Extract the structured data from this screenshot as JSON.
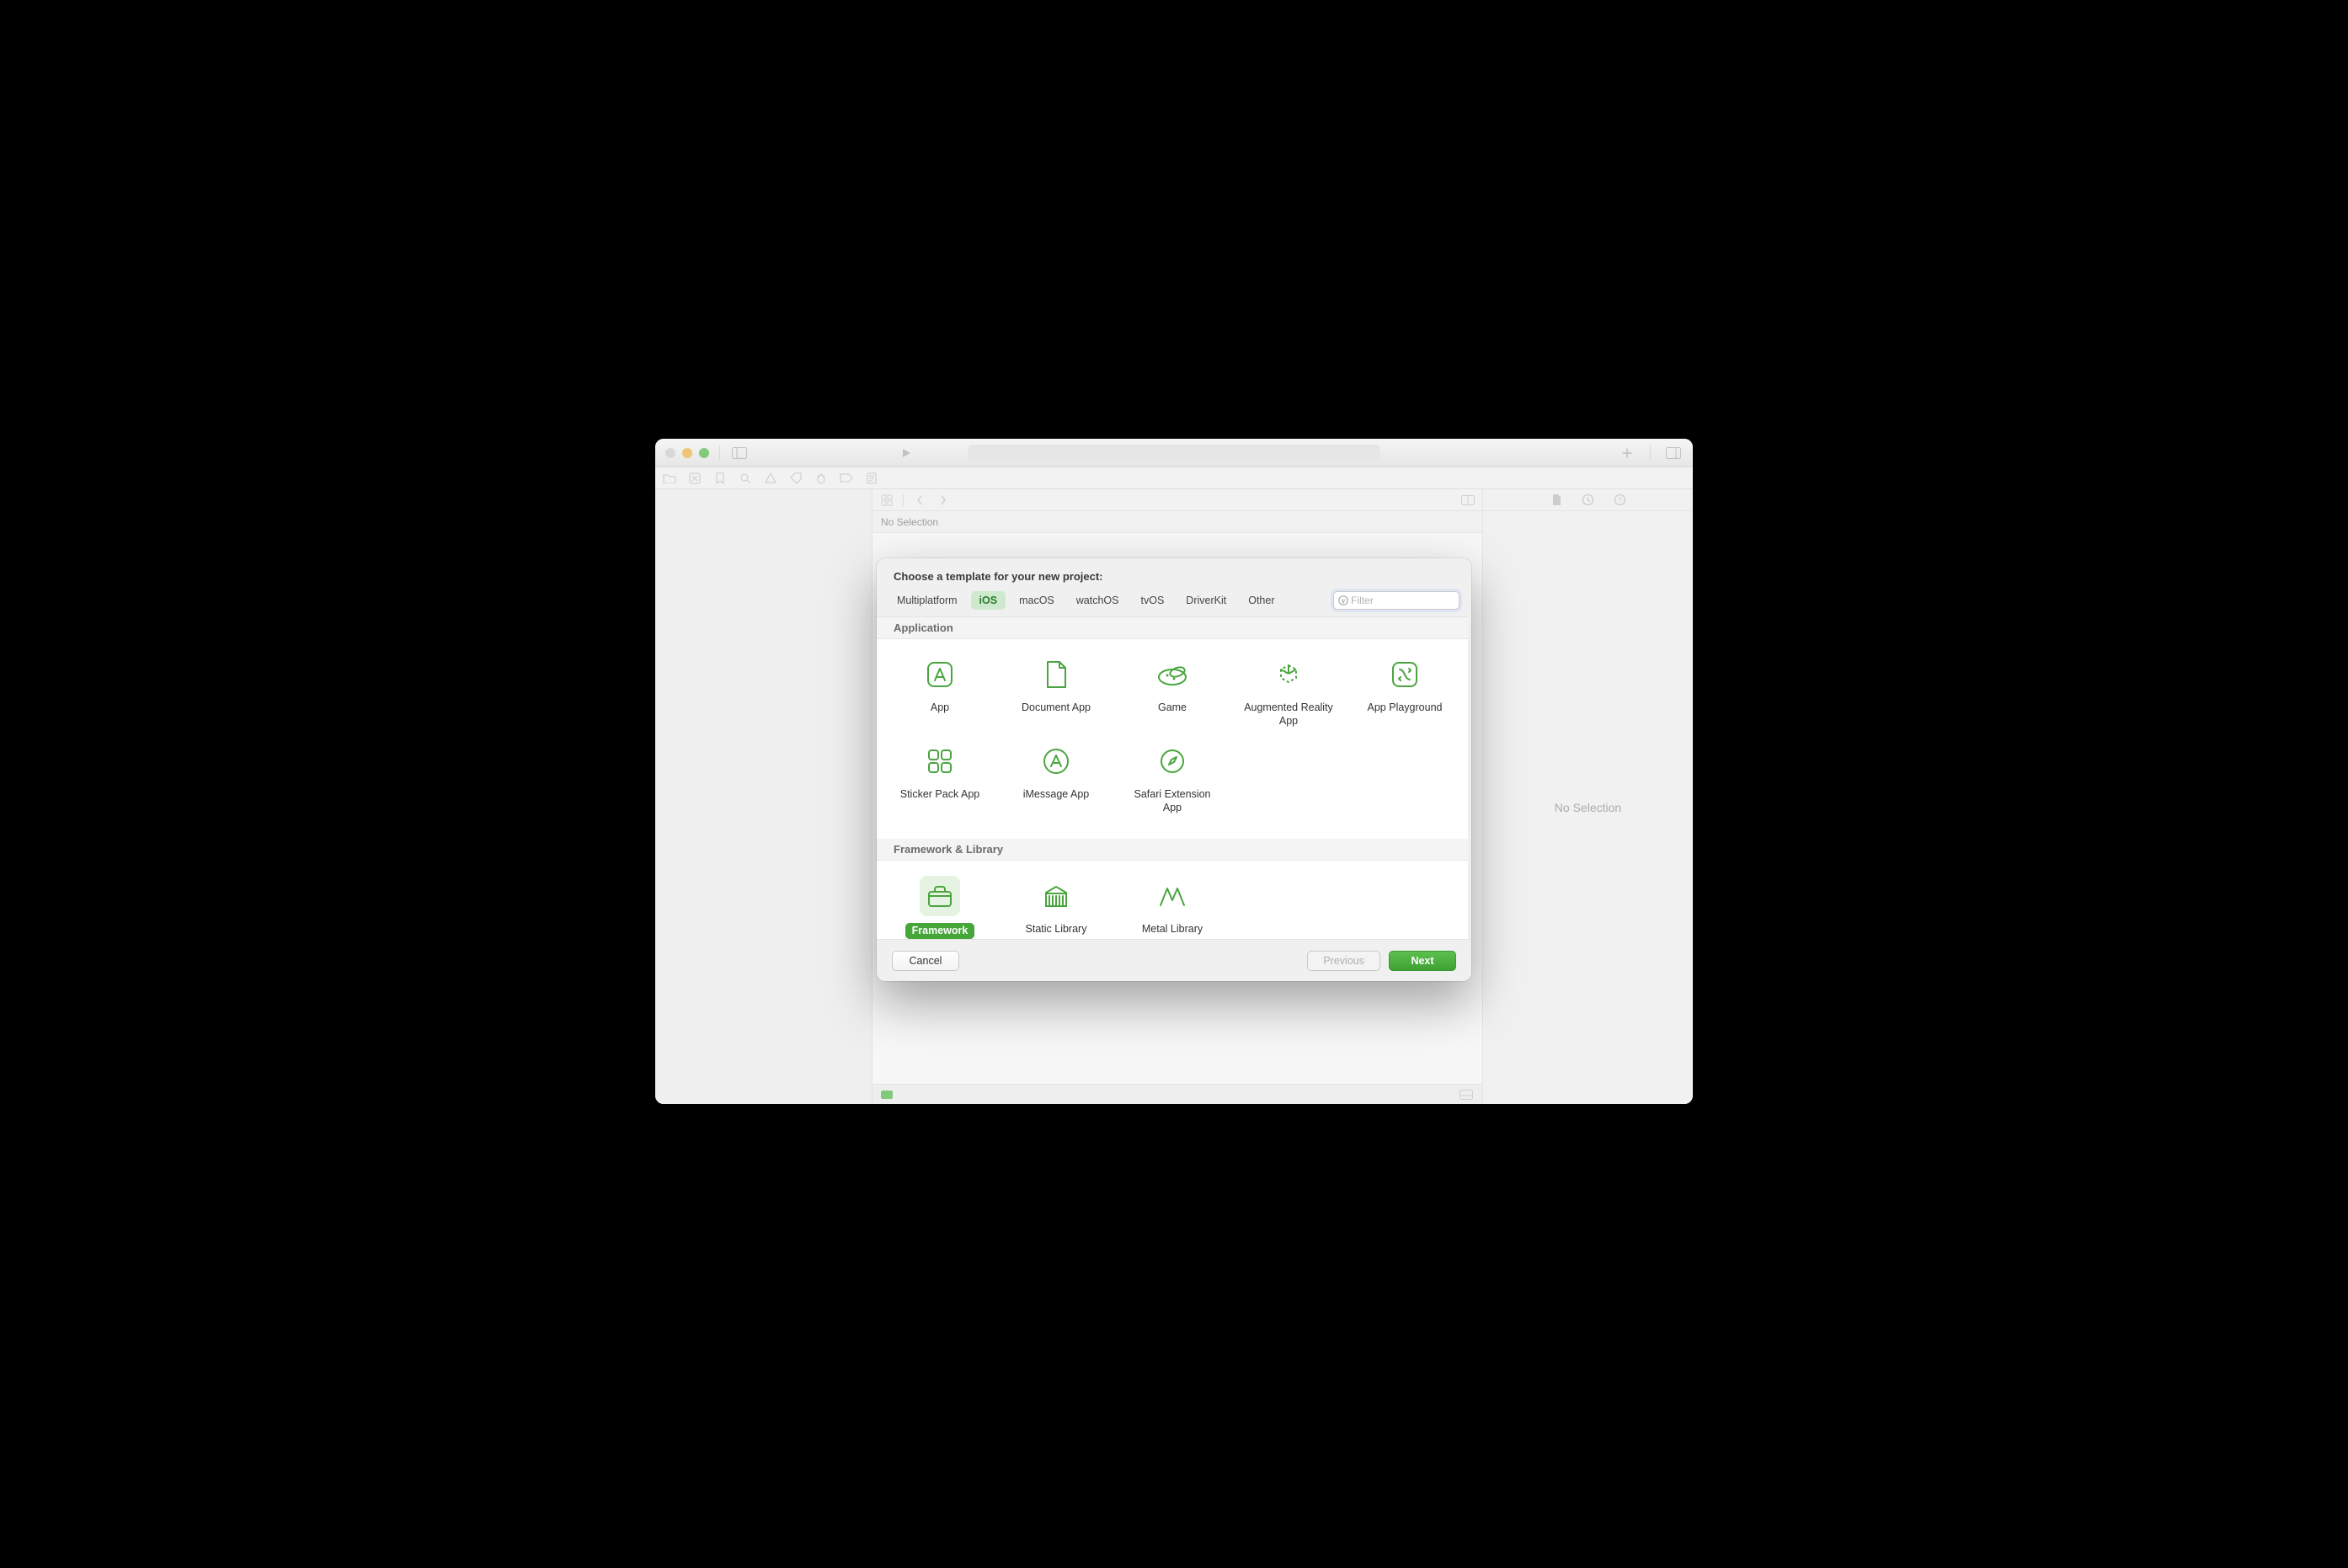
{
  "editor": {
    "no_selection": "No Selection"
  },
  "inspector": {
    "no_selection": "No Selection"
  },
  "sheet": {
    "title": "Choose a template for your new project:",
    "tabs": [
      "Multiplatform",
      "iOS",
      "macOS",
      "watchOS",
      "tvOS",
      "DriverKit",
      "Other"
    ],
    "active_tab_index": 1,
    "filter_placeholder": "Filter",
    "sections": [
      {
        "name": "Application",
        "items": [
          {
            "label": "App",
            "icon": "app"
          },
          {
            "label": "Document App",
            "icon": "document"
          },
          {
            "label": "Game",
            "icon": "game"
          },
          {
            "label": "Augmented Reality App",
            "icon": "ar"
          },
          {
            "label": "App Playground",
            "icon": "playground"
          },
          {
            "label": "Sticker Pack App",
            "icon": "sticker"
          },
          {
            "label": "iMessage App",
            "icon": "imessage"
          },
          {
            "label": "Safari Extension App",
            "icon": "safari"
          }
        ]
      },
      {
        "name": "Framework & Library",
        "items": [
          {
            "label": "Framework",
            "icon": "framework",
            "selected": true
          },
          {
            "label": "Static Library",
            "icon": "staticlib"
          },
          {
            "label": "Metal Library",
            "icon": "metal"
          }
        ]
      }
    ],
    "buttons": {
      "cancel": "Cancel",
      "previous": "Previous",
      "next": "Next"
    }
  },
  "colors": {
    "accent": "#46a63a"
  }
}
